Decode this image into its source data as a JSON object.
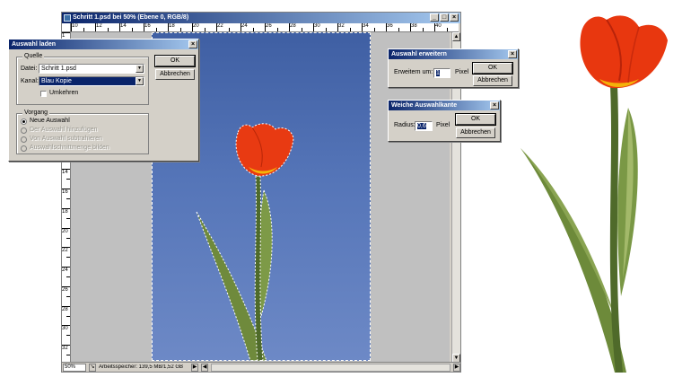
{
  "psd_window": {
    "title": "Schritt 1.psd bei 50% (Ebene 0, RGB/8)",
    "ruler_top_labels": [
      "10",
      "12",
      "14",
      "16",
      "18",
      "20",
      "22",
      "24",
      "26",
      "28",
      "30",
      "32",
      "34",
      "36",
      "38",
      "40"
    ],
    "ruler_left_labels": [
      "1",
      "3",
      "4",
      "6",
      "8",
      "10",
      "12",
      "14",
      "16",
      "18",
      "20",
      "22",
      "24",
      "26",
      "28",
      "30",
      "32"
    ],
    "status": {
      "zoom": "50%",
      "info": "Arbeitsspeicher: 139,5 MB/1,52 GB"
    }
  },
  "dialog_load_selection": {
    "title": "Auswahl laden",
    "source_group": "Quelle",
    "file_label": "Datei:",
    "file_value": "Schritt 1.psd",
    "channel_label": "Kanal:",
    "channel_value": "Blau Kopie",
    "invert_label": "Umkehren",
    "operation_group": "Vorgang",
    "options": [
      {
        "label": "Neue Auswahl",
        "checked": true,
        "disabled": false
      },
      {
        "label": "Der Auswahl hinzufügen",
        "checked": false,
        "disabled": true
      },
      {
        "label": "Von Auswahl subtrahieren",
        "checked": false,
        "disabled": true
      },
      {
        "label": "Auswahlschnittmenge bilden",
        "checked": false,
        "disabled": true
      }
    ],
    "ok": "OK",
    "cancel": "Abbrechen"
  },
  "dialog_expand": {
    "title": "Auswahl erweitern",
    "label": "Erweitern um:",
    "value": "1",
    "unit": "Pixel",
    "ok": "OK",
    "cancel": "Abbrechen"
  },
  "dialog_feather": {
    "title": "Weiche Auswahlkante",
    "label": "Radius:",
    "value": "0,6",
    "unit": "Pixel",
    "ok": "OK",
    "cancel": "Abbrechen"
  },
  "colors": {
    "sky": "#5575b8",
    "petal": "#e83a12",
    "leaf": "#6f8a3c",
    "title_bar": "#0a246a"
  }
}
